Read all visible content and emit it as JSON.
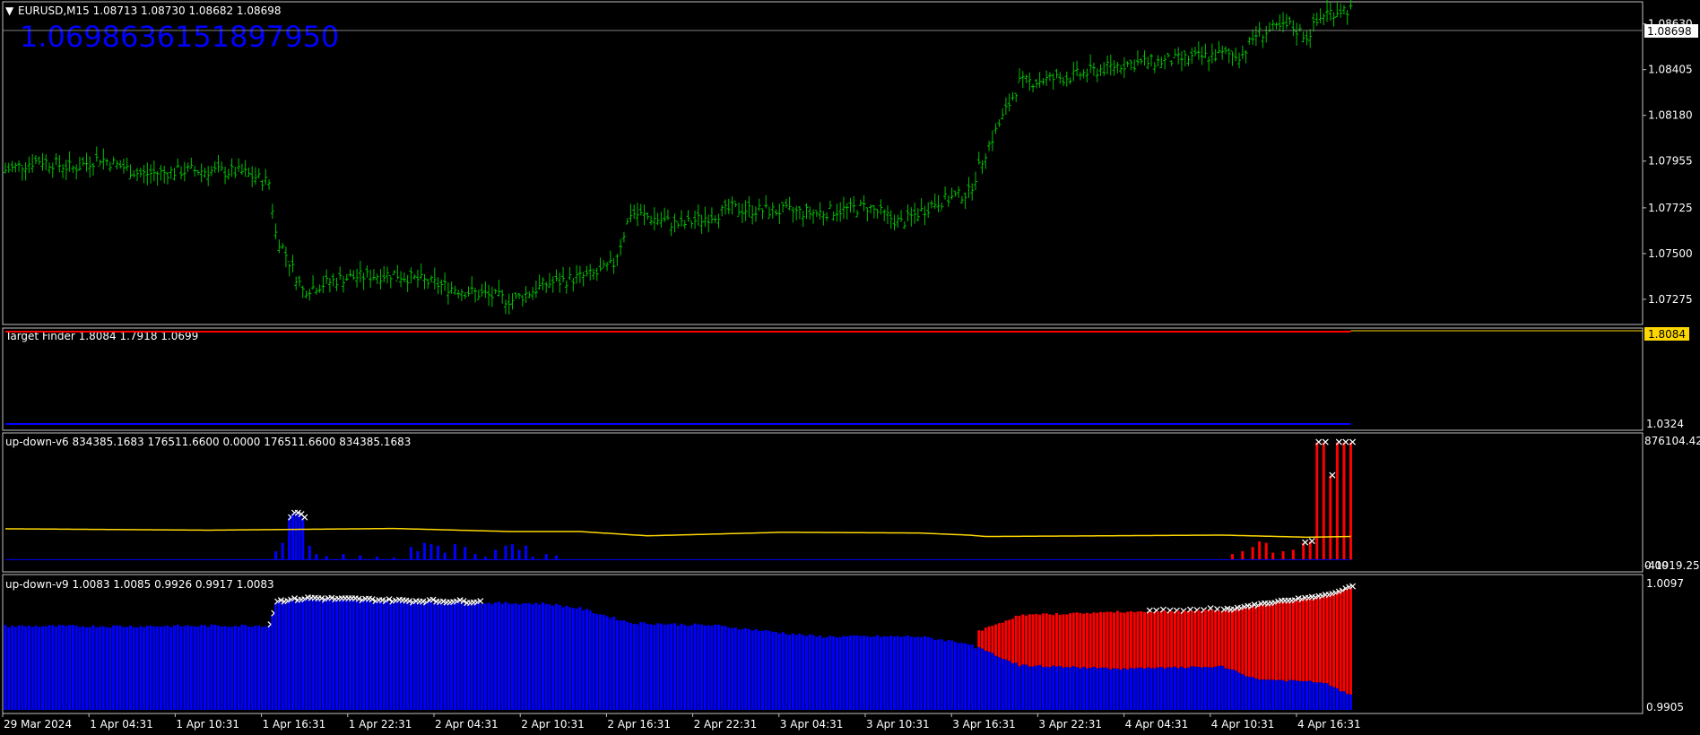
{
  "colors": {
    "background": "#000000",
    "frame": "#c0c0c0",
    "bars": "#00c000",
    "up_hist": "#0000ff",
    "down_hist": "#ff0000",
    "signal_line": "#ffd700",
    "marker": "#ffffff"
  },
  "main": {
    "header": "EURUSD,M15  1.08713 1.08730 1.08682 1.08698",
    "collapse_icon": "triangle-down-icon",
    "big_value": "1.0698636151897950",
    "price_label": "1.08698",
    "y_ticks": [
      "1.08630",
      "1.08405",
      "1.08180",
      "1.07955",
      "1.07725",
      "1.07500",
      "1.07275"
    ]
  },
  "sub1": {
    "header": "Target Finder 1.8084 1.7918 1.0699",
    "value_label": "1.8084",
    "y_ticks": [
      "1.0324"
    ]
  },
  "sub2": {
    "header": "up-down-v6 834385.1683 176511.6600 0.0000 176511.6600 834385.1683",
    "y_ticks": [
      "876104.42",
      "0.00",
      "-41919.258"
    ]
  },
  "sub3": {
    "header": "up-down-v9 1.0083 1.0085 0.9926 0.9917 1.0083",
    "y_ticks": [
      "1.0097",
      "0.9905"
    ]
  },
  "time_axis": [
    "29 Mar 2024",
    "1 Apr 04:31",
    "1 Apr 10:31",
    "1 Apr 16:31",
    "1 Apr 22:31",
    "2 Apr 04:31",
    "2 Apr 10:31",
    "2 Apr 16:31",
    "2 Apr 22:31",
    "3 Apr 04:31",
    "3 Apr 10:31",
    "3 Apr 16:31",
    "3 Apr 22:31",
    "4 Apr 04:31",
    "4 Apr 10:31",
    "4 Apr 16:31"
  ],
  "chart_data": [
    {
      "type": "ohlc",
      "x_label_period": "M15",
      "ylim": [
        1.0716,
        1.0873
      ],
      "close_path_knots": [
        [
          0,
          1.0791
        ],
        [
          10,
          1.0796
        ],
        [
          20,
          1.0792
        ],
        [
          28,
          1.0797
        ],
        [
          40,
          1.0789
        ],
        [
          55,
          1.0791
        ],
        [
          70,
          1.079
        ],
        [
          78,
          1.0785
        ],
        [
          80,
          1.076
        ],
        [
          88,
          1.0732
        ],
        [
          100,
          1.0738
        ],
        [
          115,
          1.074
        ],
        [
          135,
          1.0732
        ],
        [
          150,
          1.0727
        ],
        [
          160,
          1.0735
        ],
        [
          175,
          1.074
        ],
        [
          180,
          1.0745
        ],
        [
          185,
          1.077
        ],
        [
          200,
          1.0764
        ],
        [
          215,
          1.0772
        ],
        [
          240,
          1.077
        ],
        [
          255,
          1.0773
        ],
        [
          265,
          1.0765
        ],
        [
          275,
          1.0775
        ],
        [
          285,
          1.078
        ],
        [
          290,
          1.08
        ],
        [
          300,
          1.0834
        ],
        [
          315,
          1.0837
        ],
        [
          330,
          1.0843
        ],
        [
          345,
          1.0845
        ],
        [
          360,
          1.0848
        ],
        [
          366,
          1.0848
        ],
        [
          370,
          1.0858
        ],
        [
          380,
          1.0862
        ],
        [
          385,
          1.0857
        ],
        [
          390,
          1.0868
        ],
        [
          395,
          1.087
        ]
      ]
    },
    {
      "type": "line",
      "series": [
        {
          "values_const": 1.8084,
          "color": "#ff0000"
        },
        {
          "values_const": 1.0699,
          "color": "#0000ff"
        }
      ],
      "ylim": [
        1.0324,
        1.8084
      ]
    },
    {
      "type": "bar",
      "ylim": [
        -41919.258,
        876104.42
      ],
      "up_bars": [
        [
          80,
          60000
        ],
        [
          82,
          120000
        ],
        [
          84,
          300000
        ],
        [
          85,
          330000
        ],
        [
          86,
          330000
        ],
        [
          87,
          320000
        ],
        [
          88,
          300000
        ],
        [
          90,
          100000
        ],
        [
          92,
          40000
        ],
        [
          95,
          25000
        ],
        [
          100,
          40000
        ],
        [
          105,
          30000
        ],
        [
          110,
          20000
        ],
        [
          115,
          15000
        ],
        [
          120,
          90000
        ],
        [
          122,
          60000
        ],
        [
          124,
          120000
        ],
        [
          126,
          110000
        ],
        [
          128,
          100000
        ],
        [
          130,
          50000
        ],
        [
          133,
          110000
        ],
        [
          136,
          90000
        ],
        [
          139,
          40000
        ],
        [
          142,
          20000
        ],
        [
          145,
          70000
        ],
        [
          148,
          100000
        ],
        [
          150,
          110000
        ],
        [
          152,
          70000
        ],
        [
          154,
          100000
        ],
        [
          156,
          20000
        ],
        [
          160,
          40000
        ],
        [
          163,
          30000
        ]
      ],
      "down_bars": [
        [
          363,
          40000
        ],
        [
          366,
          60000
        ],
        [
          369,
          90000
        ],
        [
          371,
          130000
        ],
        [
          373,
          120000
        ],
        [
          375,
          50000
        ],
        [
          378,
          60000
        ],
        [
          381,
          70000
        ],
        [
          384,
          120000
        ],
        [
          386,
          130000
        ],
        [
          388,
          834385
        ],
        [
          390,
          834385
        ],
        [
          392,
          600000
        ],
        [
          394,
          834385
        ],
        [
          396,
          834385
        ],
        [
          398,
          834385
        ]
      ],
      "signal_line_knots": [
        [
          0,
          220000
        ],
        [
          60,
          210000
        ],
        [
          115,
          222000
        ],
        [
          150,
          200000
        ],
        [
          170,
          200000
        ],
        [
          190,
          170000
        ],
        [
          230,
          195000
        ],
        [
          270,
          190000
        ],
        [
          285,
          175000
        ],
        [
          290,
          165000
        ],
        [
          360,
          175000
        ],
        [
          385,
          160000
        ],
        [
          398,
          165000
        ]
      ]
    },
    {
      "type": "bar",
      "ylim": [
        0.9905,
        1.0097
      ],
      "blue_top_knots": [
        [
          0,
          1.0027
        ],
        [
          40,
          1.0027
        ],
        [
          78,
          1.0028
        ],
        [
          80,
          1.0062
        ],
        [
          90,
          1.0066
        ],
        [
          120,
          1.0062
        ],
        [
          160,
          1.006
        ],
        [
          170,
          1.0053
        ],
        [
          185,
          1.0032
        ],
        [
          210,
          1.0028
        ],
        [
          240,
          1.0012
        ],
        [
          270,
          1.0012
        ],
        [
          285,
          1.0002
        ],
        [
          287,
          0.9995
        ]
      ],
      "red_top_knots": [
        [
          288,
          1.002
        ],
        [
          300,
          1.0043
        ],
        [
          330,
          1.0048
        ],
        [
          362,
          1.005
        ],
        [
          375,
          1.006
        ],
        [
          390,
          1.007
        ],
        [
          398,
          1.0083
        ]
      ],
      "red_bottom_knots": [
        [
          288,
          0.9995
        ],
        [
          300,
          0.997
        ],
        [
          330,
          0.9965
        ],
        [
          360,
          0.9968
        ],
        [
          370,
          0.995
        ],
        [
          390,
          0.9945
        ],
        [
          398,
          0.9926
        ]
      ]
    }
  ]
}
